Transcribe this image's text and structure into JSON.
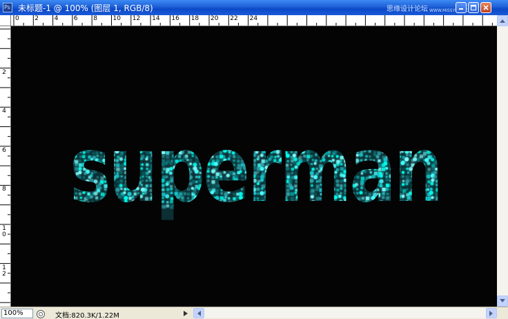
{
  "window": {
    "title": "未标题-1 @ 100% (图层 1, RGB/8)",
    "app_icon_label": "Ps",
    "watermark": "思缘设计论坛",
    "watermark_url": "WWW.MISSYUAN.COM"
  },
  "ruler": {
    "horizontal": [
      "0",
      "2",
      "4",
      "6",
      "8",
      "10",
      "12",
      "14",
      "16",
      "18",
      "20",
      "22",
      "24"
    ],
    "vertical": [
      "2",
      "4",
      "6",
      "8",
      "1\n0",
      "1\n2"
    ]
  },
  "canvas": {
    "text": "superman",
    "background": "#040404",
    "glitter_colors": [
      "#00fff0",
      "#19c9d0",
      "#2fa3ac",
      "#0e6e74",
      "#48ffff",
      "#7fffff"
    ]
  },
  "status": {
    "zoom": "100%",
    "doc_info": "文档:820.3K/1.22M"
  }
}
